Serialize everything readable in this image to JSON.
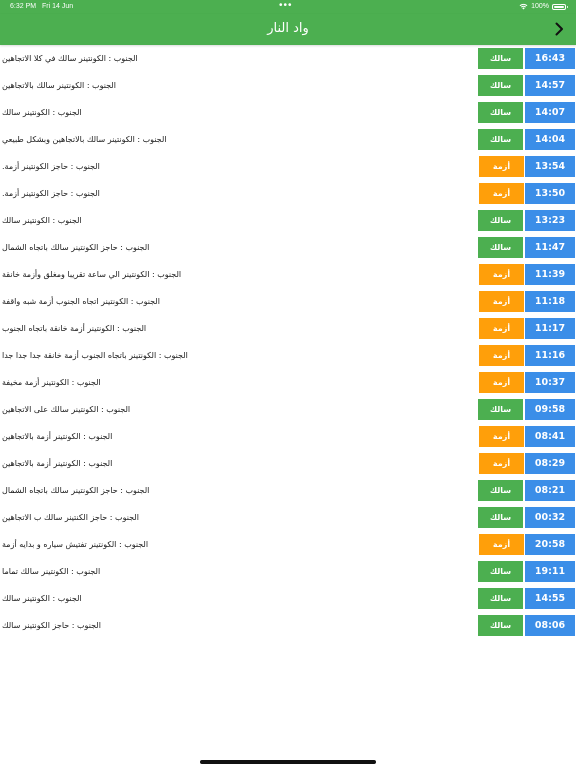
{
  "status_bar": {
    "time": "6:32 PM",
    "date": "Fri 14 Jun",
    "battery": "100%"
  },
  "nav": {
    "title": "واد النار"
  },
  "colors": {
    "green": "#4caf50",
    "orange": "#ff9f0a",
    "blue": "#3b8ee8"
  },
  "reports": [
    {
      "time": "16:43",
      "status": "سالك",
      "status_type": "green",
      "text": "الجنوب : الكونتينر سالك في كلا الاتجاهين"
    },
    {
      "time": "14:57",
      "status": "سالك",
      "status_type": "green",
      "text": "الجنوب : الكونتينر سالك بالاتجاهين"
    },
    {
      "time": "14:07",
      "status": "سالك",
      "status_type": "green",
      "text": "الجنوب : الكونتينر سالك"
    },
    {
      "time": "14:04",
      "status": "سالك",
      "status_type": "green",
      "text": "الجنوب : الكونتينر سالك بالاتجاهين وبشكل طبيعي"
    },
    {
      "time": "13:54",
      "status": "أزمة",
      "status_type": "orange",
      "text": "الجنوب : حاجز الكونتينر أزمة."
    },
    {
      "time": "13:50",
      "status": "أزمة",
      "status_type": "orange",
      "text": "الجنوب : حاجز الكونتينر أزمة."
    },
    {
      "time": "13:23",
      "status": "سالك",
      "status_type": "green",
      "text": "الجنوب : الكونتينر سالك"
    },
    {
      "time": "11:47",
      "status": "سالك",
      "status_type": "green",
      "text": "الجنوب : حاجز الكونتينر سالك باتجاه الشمال"
    },
    {
      "time": "11:39",
      "status": "أزمة",
      "status_type": "orange",
      "text": "الجنوب : الكونتينر الي ساعة تقريبا ومغلق وأزمة خانقة"
    },
    {
      "time": "11:18",
      "status": "أزمة",
      "status_type": "orange",
      "text": "الجنوب : الكونتينر اتجاه الجنوب أزمة شبه واقفة"
    },
    {
      "time": "11:17",
      "status": "أزمة",
      "status_type": "orange",
      "text": "الجنوب : الكونتينر أزمة خانقة باتجاه الجنوب"
    },
    {
      "time": "11:16",
      "status": "أزمة",
      "status_type": "orange",
      "text": "الجنوب : الكونتينر باتجاه الجنوب أزمة خانقة جدا جدا جدا"
    },
    {
      "time": "10:37",
      "status": "أزمة",
      "status_type": "orange",
      "text": "الجنوب : الكونتينر أزمة مخيفة"
    },
    {
      "time": "09:58",
      "status": "سالك",
      "status_type": "green",
      "text": "الجنوب : الكونتينر سالك على الاتجاهين"
    },
    {
      "time": "08:41",
      "status": "أزمة",
      "status_type": "orange",
      "text": "الجنوب : الكونتينر أزمة بالاتجاهين"
    },
    {
      "time": "08:29",
      "status": "أزمة",
      "status_type": "orange",
      "text": "الجنوب : الكونتينر أزمة بالاتجاهين"
    },
    {
      "time": "08:21",
      "status": "سالك",
      "status_type": "green",
      "text": "الجنوب : حاجز الكونتينر سالك باتجاه الشمال"
    },
    {
      "time": "00:32",
      "status": "سالك",
      "status_type": "green",
      "text": "الجنوب : حاجز الكنتينر سالك ب الاتجاهين"
    },
    {
      "time": "20:58",
      "status": "أزمة",
      "status_type": "orange",
      "text": "الجنوب : الكونتينر تفتيش سياره و بدايه أزمة"
    },
    {
      "time": "19:11",
      "status": "سالك",
      "status_type": "green",
      "text": "الجنوب : الكونتينر سالك تماما"
    },
    {
      "time": "14:55",
      "status": "سالك",
      "status_type": "green",
      "text": "الجنوب : الكونتينر سالك"
    },
    {
      "time": "08:06",
      "status": "سالك",
      "status_type": "green",
      "text": "الجنوب : حاجز الكونتينر سالك"
    }
  ]
}
